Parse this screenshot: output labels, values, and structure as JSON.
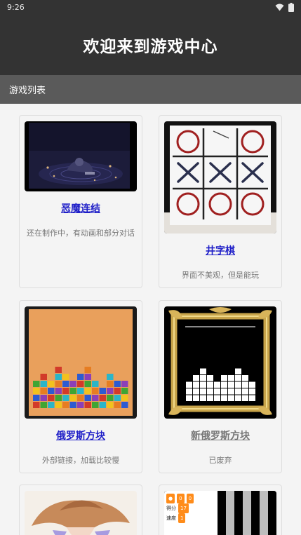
{
  "status_bar": {
    "time": "9:26"
  },
  "header": {
    "title": "欢迎来到游戏中心"
  },
  "section": {
    "title": "游戏列表"
  },
  "games": [
    {
      "title": "恶魔连结",
      "desc": "还在制作中，有动画和部分对话"
    },
    {
      "title": "井字棋",
      "desc": "界面不美观，但是能玩"
    },
    {
      "title": "俄罗斯方块",
      "desc": "外部链接，加载比较慢"
    },
    {
      "title": "新俄罗斯方块",
      "desc": "已废弃"
    }
  ],
  "scratch_preview": {
    "var1_value": "0",
    "var1_value_b": "0",
    "score_label": "得分",
    "score_value": "17",
    "level_label": "速度",
    "level_value": "1"
  },
  "colors": {
    "header_bg": "#333333",
    "section_bg": "#5a5a5a",
    "link": "#1f1fc8",
    "deprecated_link": "#777777"
  }
}
